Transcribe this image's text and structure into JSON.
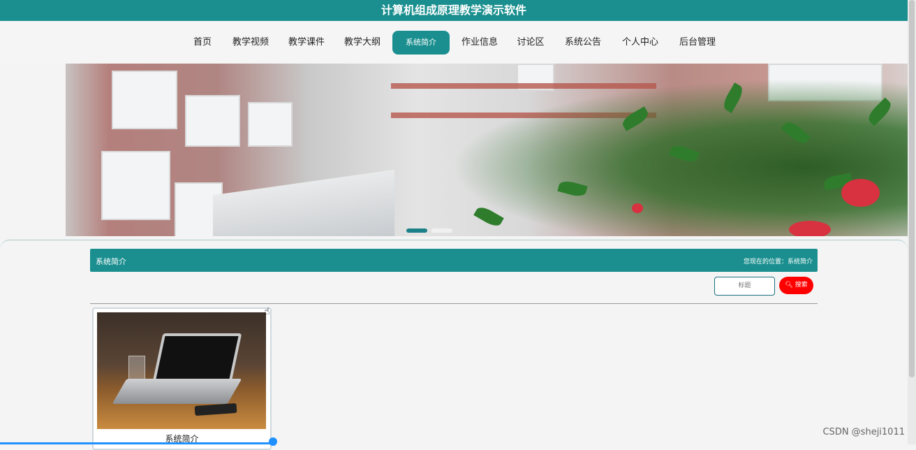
{
  "app": {
    "title": "计算机组成原理教学演示软件"
  },
  "nav": {
    "items": [
      {
        "label": "首页"
      },
      {
        "label": "教学视频"
      },
      {
        "label": "教学课件"
      },
      {
        "label": "教学大纲"
      },
      {
        "label": "系统简介",
        "active": true
      },
      {
        "label": "作业信息"
      },
      {
        "label": "讨论区"
      },
      {
        "label": "系统公告"
      },
      {
        "label": "个人中心"
      },
      {
        "label": "后台管理"
      }
    ]
  },
  "banner": {
    "slide_count": 2,
    "active_slide": 1
  },
  "section": {
    "title": "系统简介",
    "breadcrumb": "您现在的位置：系统简介"
  },
  "search": {
    "placeholder": "标题",
    "button_label": "搜索"
  },
  "cards": [
    {
      "title": "系统简介"
    }
  ],
  "watermark": "CSDN @sheji1011",
  "colors": {
    "primary": "#1b8f8f",
    "search_button": "#ff0000",
    "accent_blue": "#1e90ff"
  }
}
